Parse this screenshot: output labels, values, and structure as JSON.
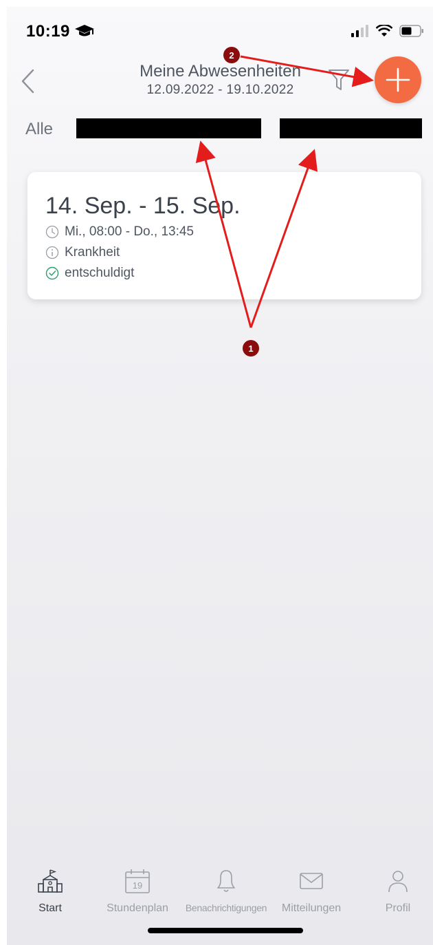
{
  "status_bar": {
    "time": "10:19"
  },
  "header": {
    "title": "Meine Abwesenheiten",
    "date_range": "12.09.2022 - 19.10.2022"
  },
  "filter_tabs": {
    "all_label": "Alle"
  },
  "absences": [
    {
      "date": "14. Sep. - 15. Sep.",
      "time": "Mi., 08:00 - Do., 13:45",
      "reason": "Krankheit",
      "status": "entschuldigt"
    }
  ],
  "annotations": {
    "badge_1": "1",
    "badge_2": "2",
    "color": "#e31c1c"
  },
  "tabbar": {
    "items": [
      {
        "label": "Start",
        "icon": "school-icon"
      },
      {
        "label": "Stundenplan",
        "icon": "calendar-icon",
        "day": "19"
      },
      {
        "label": "Benachrichtigungen",
        "icon": "bell-icon"
      },
      {
        "label": "Mitteilungen",
        "icon": "mail-icon"
      },
      {
        "label": "Profil",
        "icon": "person-icon"
      }
    ]
  },
  "colors": {
    "accent": "#f26b43",
    "success": "#2e9e6e",
    "text": "#4f5661"
  }
}
